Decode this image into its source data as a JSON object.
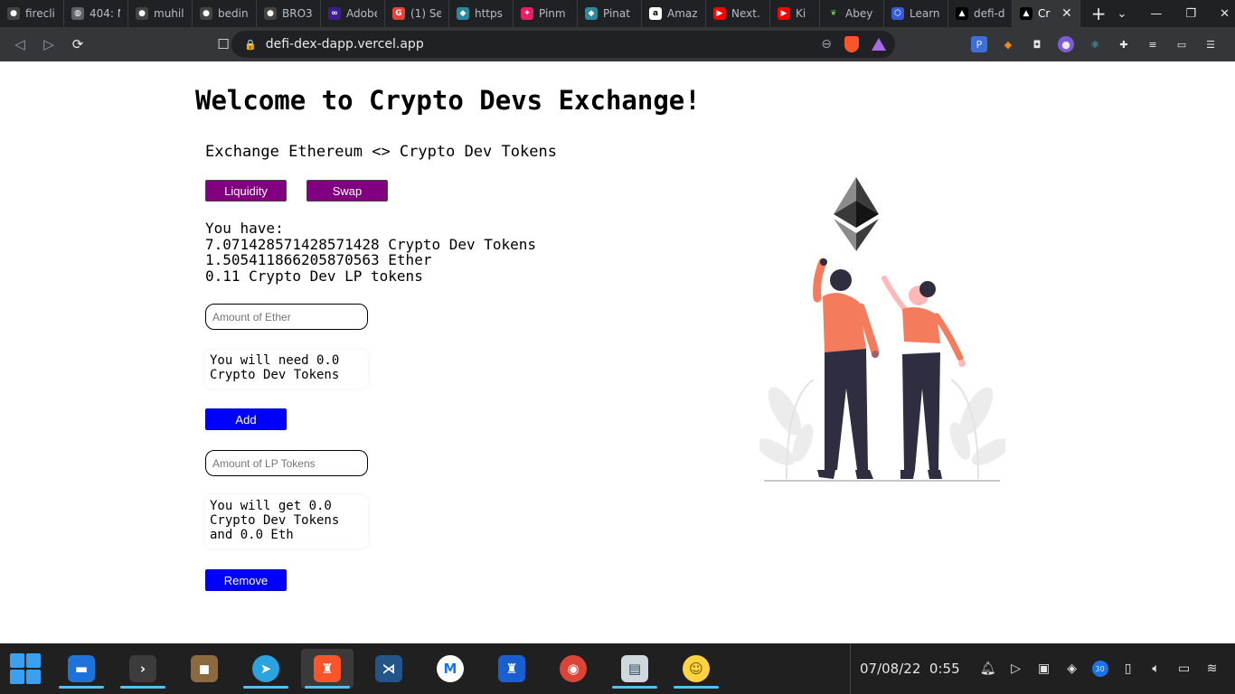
{
  "browser": {
    "tabs": [
      {
        "label": "firecli",
        "icon": "github-icon",
        "color": "#333333"
      },
      {
        "label": "404: N",
        "icon": "globe-icon",
        "color": "#5f6368"
      },
      {
        "label": "muhil",
        "icon": "github-icon",
        "color": "#333333"
      },
      {
        "label": "bedin",
        "icon": "github-icon",
        "color": "#333333"
      },
      {
        "label": "BRO3",
        "icon": "github-icon",
        "color": "#333333"
      },
      {
        "label": "Adobe",
        "icon": "adobe-icon",
        "color": "#3b1f8f"
      },
      {
        "label": "(1) Se",
        "icon": "google-icon",
        "color": "#ea4335"
      },
      {
        "label": "https",
        "icon": "cube-icon",
        "color": "#2d8a9c"
      },
      {
        "label": "Pinm",
        "icon": "pinmap-icon",
        "color": "#e91e63"
      },
      {
        "label": "Pinat",
        "icon": "pinata-icon",
        "color": "#2d8a9c"
      },
      {
        "label": "Amaz",
        "icon": "amazon-icon",
        "color": "#ffffff"
      },
      {
        "label": "Next.",
        "icon": "youtube-icon",
        "color": "#ff0000"
      },
      {
        "label": "Ki",
        "icon": "youtube-icon",
        "color": "#ff0000"
      },
      {
        "label": "Abey",
        "icon": "leaf-icon",
        "color": "#6abf4b"
      },
      {
        "label": "Learn",
        "icon": "chainlink-icon",
        "color": "#375bd2"
      },
      {
        "label": "defi-d",
        "icon": "vercel-icon",
        "color": "#000000"
      },
      {
        "label": "Cr",
        "icon": "vercel-icon",
        "color": "#000000",
        "active": true
      }
    ],
    "new_tab": "+",
    "url": "defi-dex-dapp.vercel.app"
  },
  "page": {
    "title": "Welcome to Crypto Devs Exchange!",
    "subtitle": "Exchange Ethereum <> Crypto Dev Tokens",
    "liquidity_label": "Liquidity",
    "swap_label": "Swap",
    "balances": {
      "heading": "You have:",
      "cd_tokens": "7.071428571428571428 Crypto Dev Tokens",
      "ether": "1.505411866205870563 Ether",
      "lp_tokens": "0.11 Crypto Dev LP tokens"
    },
    "ether_input": {
      "placeholder": "Amount of Ether",
      "value": ""
    },
    "need_line1": "You will need 0.0",
    "need_line2": "Crypto Dev Tokens",
    "add_label": "Add",
    "lp_input": {
      "placeholder": "Amount of LP Tokens",
      "value": ""
    },
    "get_line1": "You will get 0.0",
    "get_line2": "Crypto Dev Tokens",
    "get_line3": "and 0.0 Eth",
    "remove_label": "Remove"
  },
  "taskbar": {
    "apps": [
      "file-explorer",
      "terminal",
      "minecraft",
      "telegram",
      "brave",
      "vscode",
      "maps",
      "brave-beta",
      "chrome-beta",
      "books",
      "emoji"
    ],
    "date": "07/08/22",
    "time": "0:55",
    "tray_badge": "30"
  }
}
